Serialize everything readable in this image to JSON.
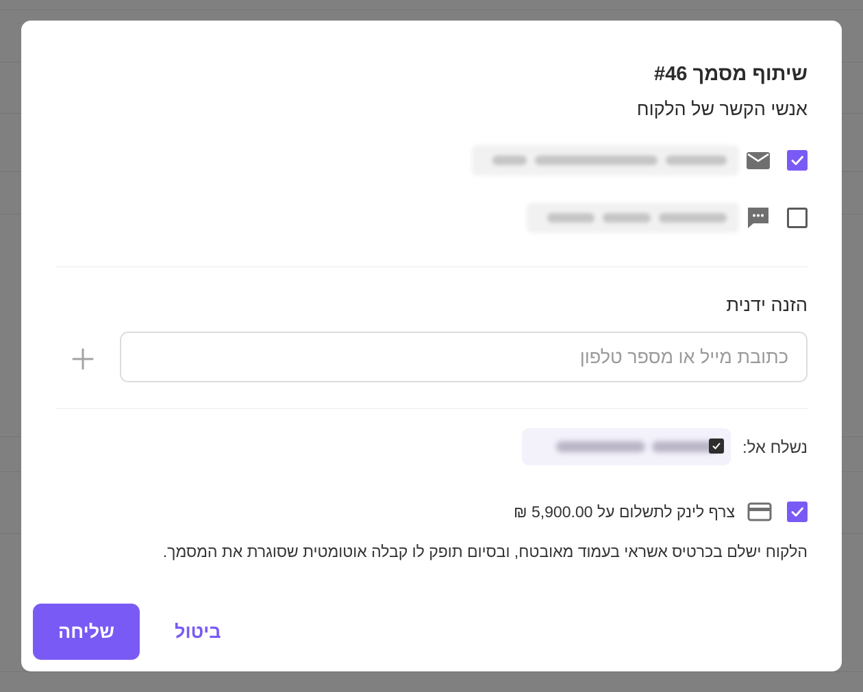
{
  "modal": {
    "title": "שיתוף מסמך #46",
    "contacts_label": "אנשי הקשר של הלקוח",
    "contacts": [
      {
        "channel": "mail-icon",
        "checked": true
      },
      {
        "channel": "sms-icon",
        "checked": false
      }
    ],
    "manual_label": "הזנה ידנית",
    "input_placeholder": "כתובת מייל או מספר טלפון",
    "input_value": "",
    "add_symbol": "+",
    "sent_to_label": "נשלח אל:",
    "payment_label": "צרף לינק לתשלום על 5,900.00 ₪",
    "payment_checked": true,
    "payment_icon": "credit-card-icon",
    "description": "הלקוח ישלם בכרטיס אשראי בעמוד מאובטח, ובסיום תופק לו קבלה אוטומטית שסוגרת את המסמך.",
    "send_label": "שליחה",
    "cancel_label": "ביטול",
    "accent_color": "#7a5af5"
  }
}
